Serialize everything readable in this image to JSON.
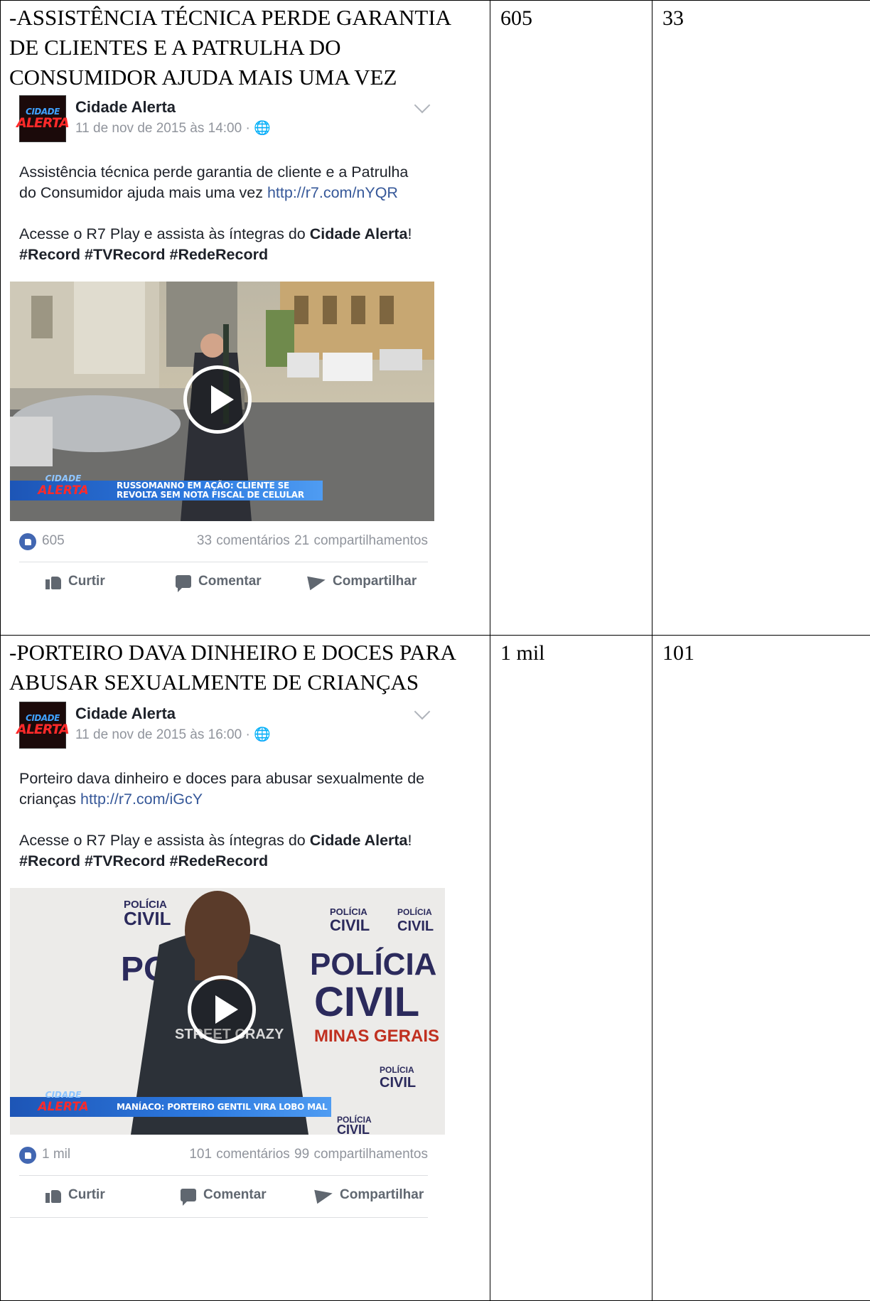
{
  "rows": [
    {
      "heading": "-ASSISTÊNCIA TÉCNICA PERDE GARANTIA DE CLIENTES E A PATRULHA DO CONSUMIDOR AJUDA MAIS UMA VEZ",
      "likes_col": "605",
      "comments_col": "33",
      "post": {
        "page_name": "Cidade Alerta",
        "avatar_top": "CIDADE",
        "avatar_bottom": "ALERTA",
        "date": "11 de nov de 2015 às 14:00 · 🌐",
        "text_main": "Assistência técnica perde garantia de cliente e a Patrulha do Consumidor ajuda mais uma vez ",
        "text_link": "http://r7.com/nYQR",
        "text_cta_a": "Acesse o R7 Play e assista às íntegras do ",
        "text_cta_b": "Cidade Alerta",
        "text_cta_c": "! ",
        "text_tags": "#Record #TVRecord #RedeRecord",
        "video_tag_top": "CIDADE",
        "video_tag": "ALERTA",
        "video_caption_1": "RUSSOMANNO EM AÇÃO: CLIENTE SE",
        "video_caption_2": "REVOLTA SEM NOTA FISCAL DE CELULAR",
        "likes": "605",
        "comments_shares": "33 comentários  21 compartilhamentos",
        "action_like": "Curtir",
        "action_comment": "Comentar",
        "action_share": "Compartilhar"
      }
    },
    {
      "heading": "-PORTEIRO DAVA DINHEIRO E DOCES PARA ABUSAR SEXUALMENTE DE CRIANÇAS",
      "likes_col": "1 mil",
      "comments_col": "101",
      "post": {
        "page_name": "Cidade Alerta",
        "avatar_top": "CIDADE",
        "avatar_bottom": "ALERTA",
        "date": "11 de nov de 2015 às 16:00 · 🌐",
        "text_main": "Porteiro dava dinheiro e doces para abusar sexualmente de crianças ",
        "text_link": "http://r7.com/iGcY",
        "text_cta_a": "Acesse o R7 Play e assista às íntegras do ",
        "text_cta_b": "Cidade Alerta",
        "text_cta_c": "! ",
        "text_tags": "#Record #TVRecord #RedeRecord",
        "video_tag_top": "CIDADE",
        "video_tag": "ALERTA",
        "video_caption_1": "MANÍACO: PORTEIRO GENTIL VIRA LOBO MAL",
        "video_caption_2": "",
        "backdrop_1": "POLÍCIA",
        "backdrop_2": "CIVIL",
        "backdrop_3": "MINAS GERAIS",
        "shirt_text": "STREET CRAZY",
        "likes": "1 mil",
        "comments_shares": "101 comentários  99 compartilhamentos",
        "action_like": "Curtir",
        "action_comment": "Comentar",
        "action_share": "Compartilhar"
      }
    }
  ]
}
